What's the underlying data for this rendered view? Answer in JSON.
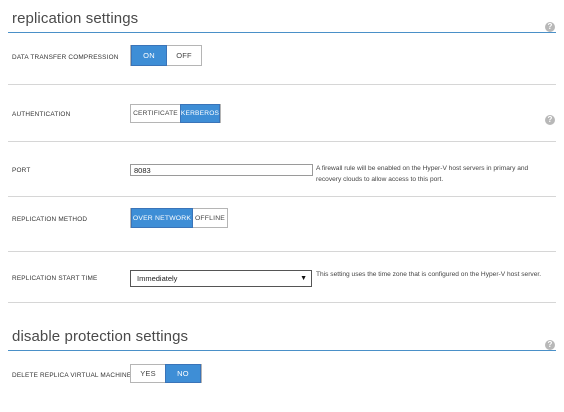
{
  "replication": {
    "title": "replication settings",
    "help_icon": "question-icon",
    "compression": {
      "label": "DATA TRANSFER COMPRESSION",
      "options": [
        "ON",
        "OFF"
      ],
      "selected": "ON"
    },
    "authentication": {
      "label": "AUTHENTICATION",
      "options": [
        "CERTIFICATE",
        "KERBEROS"
      ],
      "selected": "KERBEROS",
      "help_icon": "question-icon"
    },
    "port": {
      "label": "PORT",
      "value": "8083",
      "note": "A firewall rule will be enabled on the Hyper-V host servers in primary and recovery clouds to allow access to this port."
    },
    "method": {
      "label": "REPLICATION METHOD",
      "options": [
        "OVER NETWORK",
        "OFFLINE"
      ],
      "selected": "OVER NETWORK"
    },
    "start_time": {
      "label": "REPLICATION START TIME",
      "value": "Immediately",
      "note": "This setting uses the time zone that is configured on the Hyper-V host server."
    }
  },
  "disable_protection": {
    "title": "disable protection settings",
    "help_icon": "question-icon",
    "delete_replica": {
      "label": "DELETE REPLICA VIRTUAL MACHINE",
      "options": [
        "YES",
        "NO"
      ],
      "selected": "NO"
    }
  },
  "colors": {
    "accent": "#3e8ed6",
    "rule": "#4a90c8",
    "separator": "#d6d6d6"
  }
}
